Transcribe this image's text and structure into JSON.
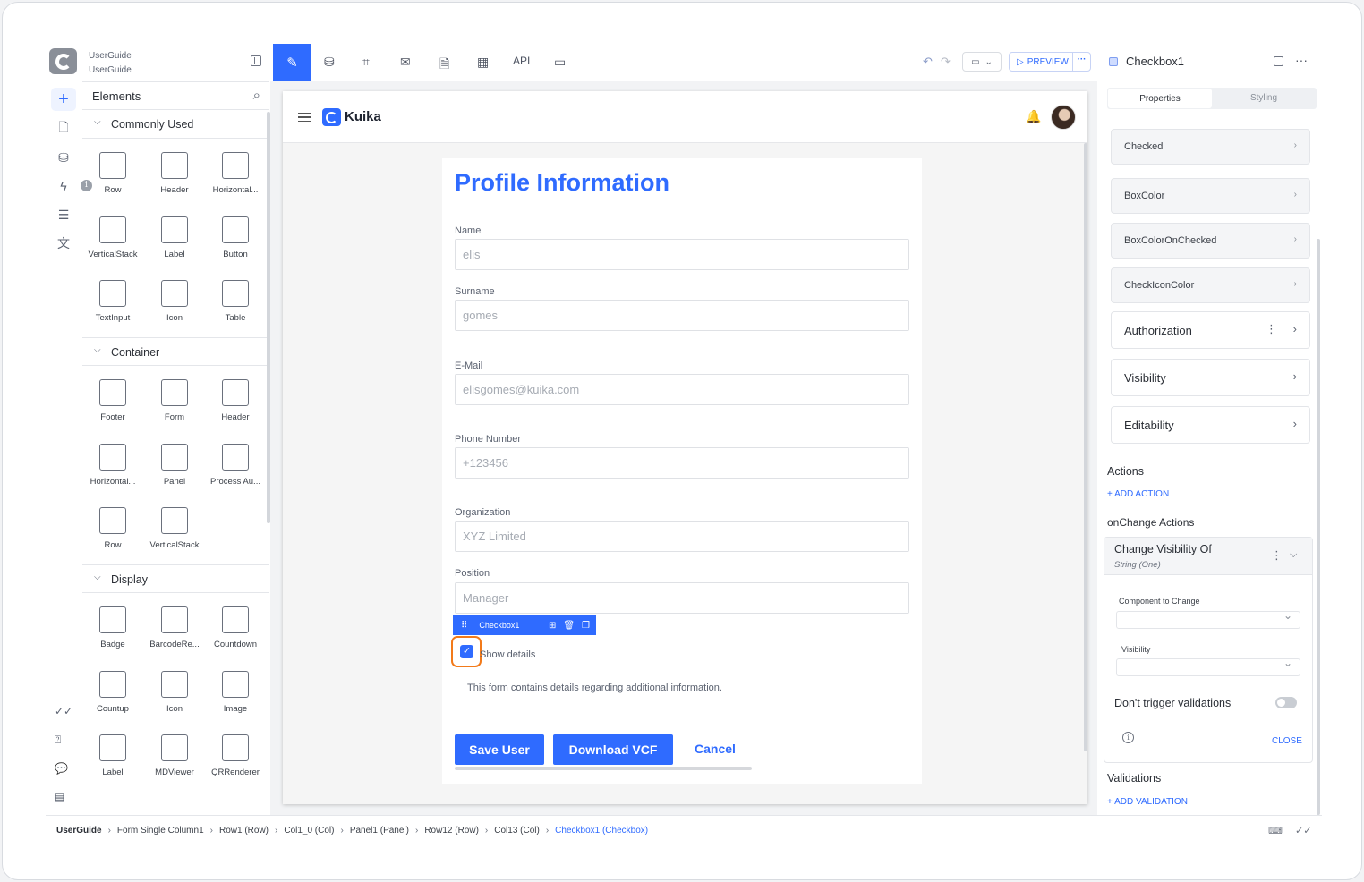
{
  "app": {
    "title_line1": "UserGuide",
    "title_line2": "UserGuide"
  },
  "elements_panel": {
    "title": "Elements",
    "sections": [
      {
        "name": "Commonly Used",
        "items": [
          "Row",
          "Header",
          "Horizontal...",
          "VerticalStack",
          "Label",
          "Button",
          "TextInput",
          "Icon",
          "Table"
        ]
      },
      {
        "name": "Container",
        "items": [
          "Footer",
          "Form",
          "Header",
          "Horizontal...",
          "Panel",
          "Process Au...",
          "Row",
          "VerticalStack"
        ]
      },
      {
        "name": "Display",
        "items": [
          "Badge",
          "BarcodeRe...",
          "Countdown",
          "Countup",
          "Icon",
          "Image",
          "Label",
          "MDViewer",
          "QRRenderer"
        ]
      }
    ]
  },
  "toolbar": {
    "api_label": "API",
    "preview_label": "PREVIEW",
    "preview_more": "···"
  },
  "canvas": {
    "brand": "Kuika",
    "form": {
      "title": "Profile Information",
      "fields": [
        {
          "label": "Name",
          "value": "elis"
        },
        {
          "label": "Surname",
          "value": "gomes"
        },
        {
          "label": "E-Mail",
          "value": "elisgomes@kuika.com"
        },
        {
          "label": "Phone Number",
          "value": "+123456"
        },
        {
          "label": "Organization",
          "value": "XYZ Limited"
        },
        {
          "label": "Position",
          "value": "Manager"
        }
      ],
      "selection_bar_name": "Checkbox1",
      "checkbox_label": "Show details",
      "checkbox_checked": true,
      "note": "This form contains details regarding additional information.",
      "buttons": {
        "save": "Save User",
        "download": "Download VCF",
        "cancel": "Cancel"
      }
    }
  },
  "properties_panel": {
    "title": "Checkbox1",
    "tabs": [
      "Properties",
      "Styling"
    ],
    "style_props": [
      "Checked",
      "BoxColor",
      "BoxColorOnChecked",
      "CheckIconColor"
    ],
    "sections": [
      "Authorization",
      "Visibility",
      "Editability"
    ],
    "actions_title": "Actions",
    "add_action": "+ ADD ACTION",
    "onchange_title": "onChange Actions",
    "action": {
      "title": "Change Visibility Of",
      "subtitle": "String (One)",
      "component_label": "Component to Change",
      "visibility_label": "Visibility",
      "toggle_label": "Don't trigger validations",
      "toggle_on": false,
      "close": "CLOSE"
    },
    "validations_title": "Validations",
    "add_validation": "+ ADD VALIDATION"
  },
  "breadcrumb": [
    "UserGuide",
    "Form Single Column1",
    "Row1 (Row)",
    "Col1_0 (Col)",
    "Panel1 (Panel)",
    "Row12 (Row)",
    "Col13 (Col)",
    "Checkbox1 (Checkbox)"
  ],
  "colors": {
    "accent": "#2f6bff",
    "highlight": "#f27a1a"
  }
}
